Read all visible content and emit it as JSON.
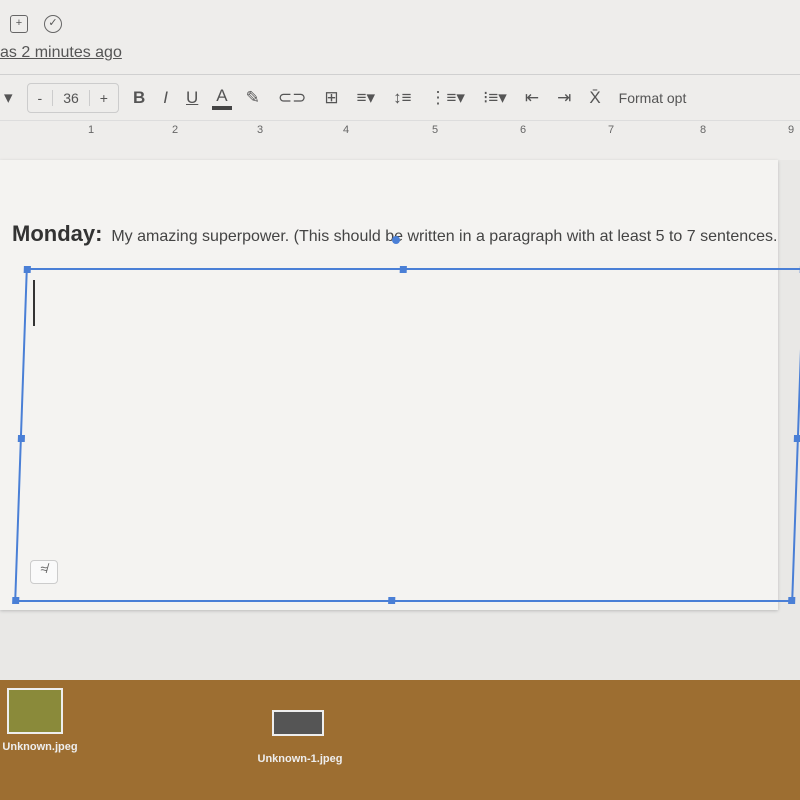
{
  "header": {
    "saved_status": "as 2 minutes ago"
  },
  "toolbar": {
    "font_size": "36",
    "minus": "-",
    "plus": "+",
    "bold": "B",
    "italic": "I",
    "underline": "U",
    "text_color": "A",
    "format_options": "Format opt"
  },
  "ruler": {
    "marks": [
      "1",
      "2",
      "3",
      "4",
      "5",
      "6",
      "7",
      "8",
      "9"
    ]
  },
  "document": {
    "heading": "Monday:",
    "prompt": "My amazing superpower.  (This should be written in a paragraph with at least 5 to 7 sentences."
  },
  "desktop": {
    "files": [
      "Unknown.jpeg",
      "Unknown-1.jpeg"
    ]
  }
}
